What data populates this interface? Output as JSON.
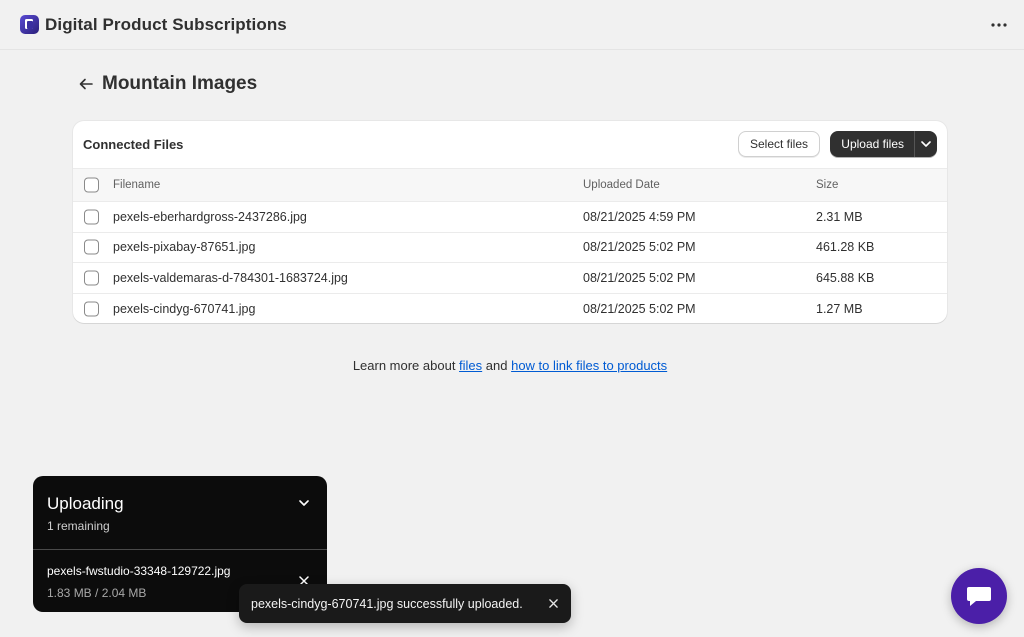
{
  "app": {
    "title": "Digital Product Subscriptions",
    "icon": "app-logo-icon",
    "more_icon": "more-horizontal-icon"
  },
  "page": {
    "title": "Mountain Images",
    "back_icon": "arrow-left-icon"
  },
  "card": {
    "title": "Connected Files",
    "select_files_label": "Select files",
    "upload_files_label": "Upload files",
    "upload_menu_icon": "chevron-down-icon",
    "columns": [
      "Filename",
      "Uploaded Date",
      "Size"
    ],
    "rows": [
      {
        "filename": "pexels-eberhardgross-2437286.jpg",
        "uploaded": "08/21/2025 4:59 PM",
        "size": "2.31 MB"
      },
      {
        "filename": "pexels-pixabay-87651.jpg",
        "uploaded": "08/21/2025 5:02 PM",
        "size": "461.28 KB"
      },
      {
        "filename": "pexels-valdemaras-d-784301-1683724.jpg",
        "uploaded": "08/21/2025 5:02 PM",
        "size": "645.88 KB"
      },
      {
        "filename": "pexels-cindyg-670741.jpg",
        "uploaded": "08/21/2025 5:02 PM",
        "size": "1.27 MB"
      }
    ]
  },
  "learn_more": {
    "prefix": "Learn more about ",
    "files_link": "files",
    "middle": " and ",
    "link_products": "how to link files to products"
  },
  "upload_panel": {
    "title": "Uploading",
    "remaining": "1 remaining",
    "item_name": "pexels-fwstudio-33348-129722.jpg",
    "item_progress": "1.83 MB / 2.04 MB",
    "collapse_icon": "chevron-down-icon",
    "cancel_icon": "close-icon"
  },
  "toast": {
    "message": "pexels-cindyg-670741.jpg successfully uploaded.",
    "close_icon": "close-icon"
  },
  "chat": {
    "icon": "chat-bubble-icon"
  },
  "colors": {
    "background": "#f1f1f1",
    "primary_button": "#303030",
    "link": "#005bd3",
    "chat": "#4b1fa8",
    "panel": "#0c0c0c"
  }
}
